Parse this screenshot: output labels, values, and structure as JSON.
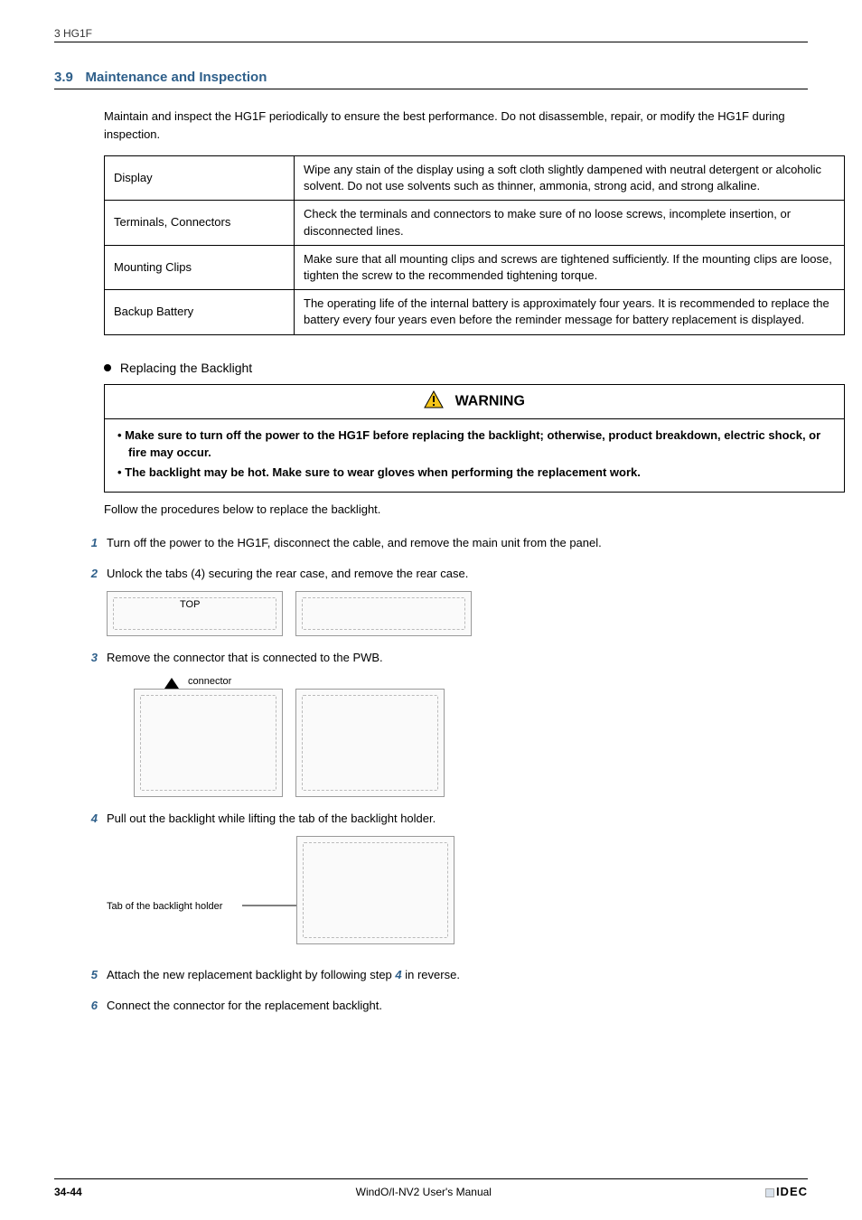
{
  "header": {
    "path": "3 HG1F"
  },
  "section": {
    "number": "3.9",
    "title": "Maintenance and Inspection",
    "intro": "Maintain and inspect the HG1F periodically to ensure the best performance. Do not disassemble, repair, or modify the HG1F during inspection."
  },
  "table": {
    "rows": [
      {
        "label": "Display",
        "desc": "Wipe any stain of the display using a soft cloth slightly dampened with neutral detergent or alcoholic solvent. Do not use solvents such as thinner, ammonia, strong acid, and strong alkaline."
      },
      {
        "label": "Terminals, Connectors",
        "desc": "Check the terminals and connectors to make sure of no loose screws, incomplete insertion, or disconnected lines."
      },
      {
        "label": "Mounting Clips",
        "desc": "Make sure that all mounting clips and screws are tightened sufficiently. If the mounting clips are loose, tighten the screw to the recommended tightening torque."
      },
      {
        "label": "Backup Battery",
        "desc": "The operating life of the internal battery is approximately four years. It is recommended to replace the battery every four years even before the reminder message for battery replacement is displayed."
      }
    ]
  },
  "backlight": {
    "heading": "Replacing the Backlight",
    "warning_title": "WARNING",
    "warning_items": [
      "Make sure to turn off the power to the HG1F before replacing the backlight; otherwise, product breakdown, electric shock, or fire may occur.",
      "The backlight may be hot. Make sure to wear gloves when performing the replacement work."
    ],
    "follow": "Follow the procedures below to replace the backlight.",
    "steps": [
      {
        "n": "1",
        "text": "Turn off the power to the HG1F, disconnect the cable, and remove the main unit from the panel."
      },
      {
        "n": "2",
        "text": "Unlock the tabs (4) securing the rear case, and remove the rear case."
      },
      {
        "n": "3",
        "text": "Remove the connector that is connected to the PWB."
      },
      {
        "n": "4",
        "text": "Pull out the backlight while lifting the tab of the backlight holder."
      },
      {
        "n": "5",
        "text_pre": "Attach the new replacement backlight by following step ",
        "ref": "4",
        "text_post": " in reverse."
      },
      {
        "n": "6",
        "text": "Connect the connector for the replacement backlight."
      }
    ],
    "fig_labels": {
      "connector": "connector",
      "tab_holder": "Tab of the backlight holder",
      "top": "TOP"
    }
  },
  "footer": {
    "page": "34-44",
    "center": "WindO/I-NV2 User's Manual",
    "brand": "IDEC"
  }
}
